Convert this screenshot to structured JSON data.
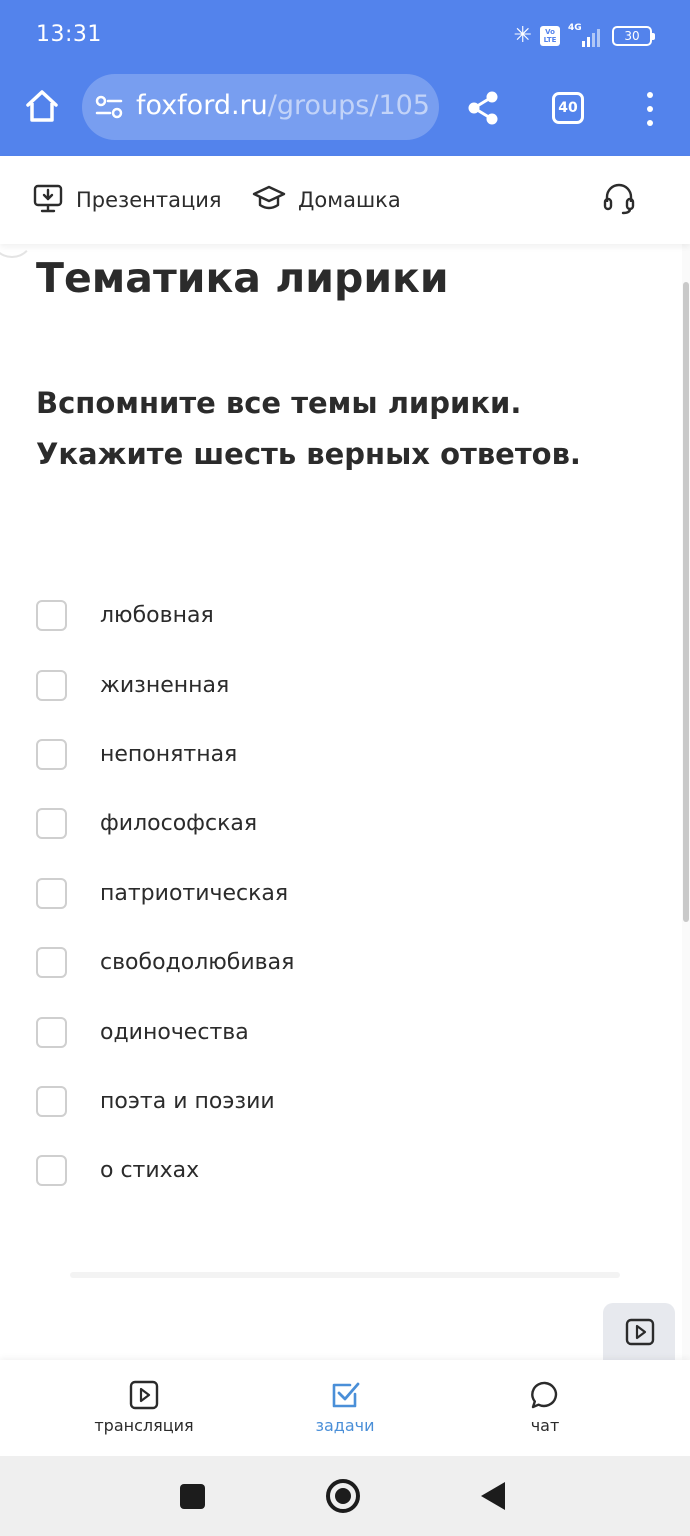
{
  "status_bar": {
    "time": "13:31",
    "network": "4G",
    "volte_label": "Vo LTE",
    "battery": "30",
    "bluetooth_icon": "bluetooth-icon"
  },
  "browser": {
    "url_domain": "foxford.ru",
    "url_path": "/groups/105",
    "tab_count": "40",
    "icons": [
      "home-icon",
      "site-settings-icon",
      "share-icon",
      "tab-switcher-icon",
      "overflow-menu-icon"
    ]
  },
  "page_nav": {
    "presentation_label": "Презентация",
    "homework_label": "Домашка",
    "icons": [
      "download-monitor-icon",
      "graduation-cap-icon",
      "headset-icon"
    ]
  },
  "lesson": {
    "title": "Тематика лирики",
    "question": "Вспомните все темы лирики. Укажите шесть верных ответов.",
    "options": [
      {
        "label": "любовная",
        "checked": false
      },
      {
        "label": "жизненная",
        "checked": false
      },
      {
        "label": "непонятная",
        "checked": false
      },
      {
        "label": "философская",
        "checked": false
      },
      {
        "label": "патриотическая",
        "checked": false
      },
      {
        "label": "свободолюбивая",
        "checked": false
      },
      {
        "label": "одиночества",
        "checked": false
      },
      {
        "label": "поэта и поэзии",
        "checked": false
      },
      {
        "label": "о стихах",
        "checked": false
      }
    ]
  },
  "bottom_tabs": {
    "broadcast_label": "трансляция",
    "tasks_label": "задачи",
    "chat_label": "чат",
    "active_tab": "задачи"
  },
  "colors": {
    "browser_bar": "#5383EC",
    "active_tab": "#4a8fd8",
    "text": "#2b2b2b"
  }
}
